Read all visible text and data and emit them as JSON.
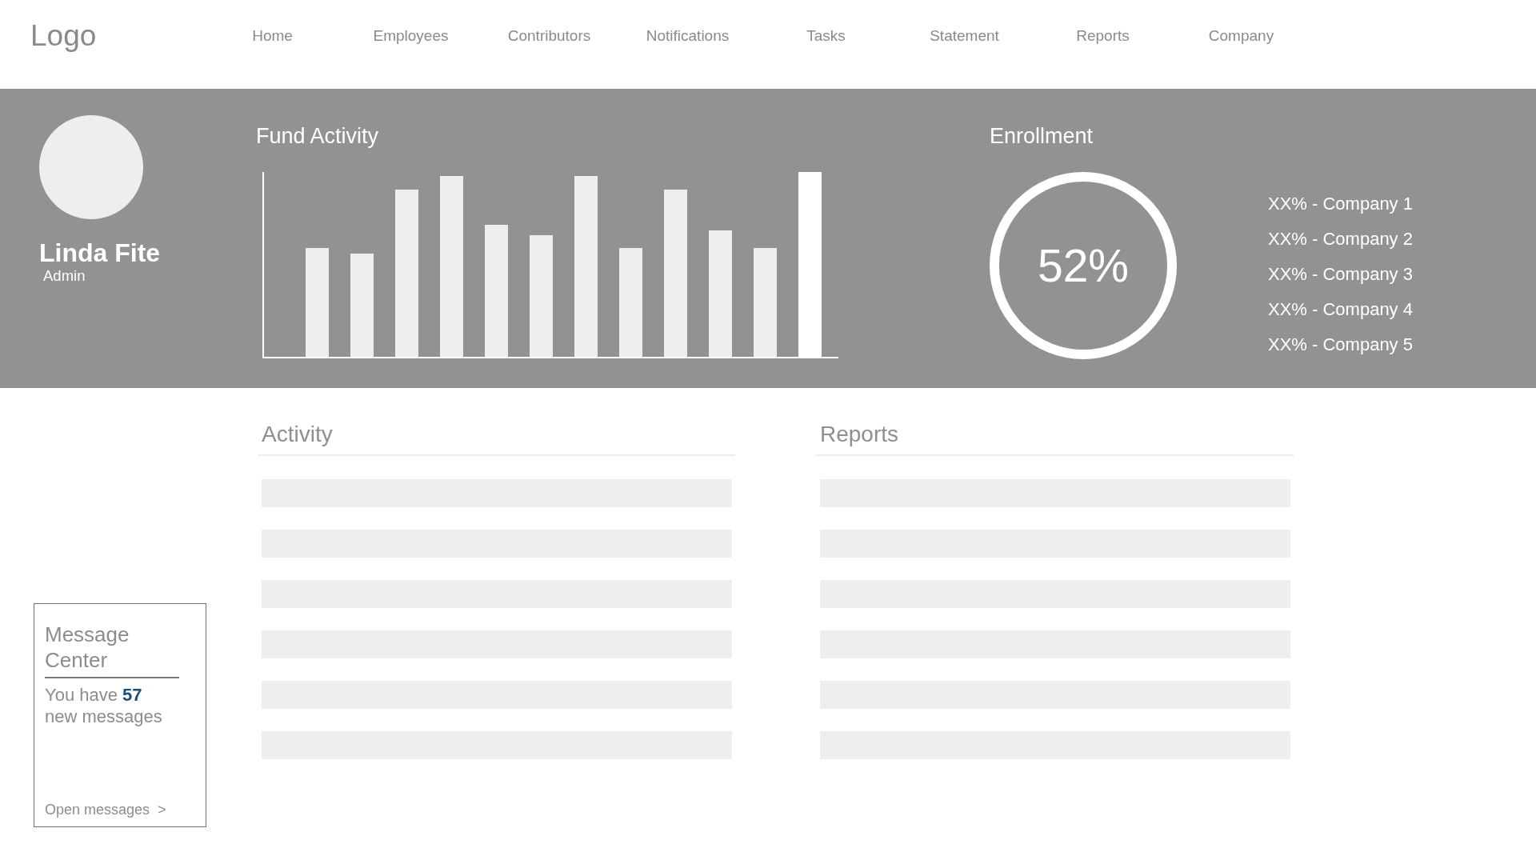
{
  "header": {
    "logo": "Logo",
    "nav": [
      "Home",
      "Employees",
      "Contributors",
      "Notifications",
      "Tasks",
      "Statement",
      "Reports",
      "Company"
    ]
  },
  "profile": {
    "name": "Linda Fite",
    "role": "Admin"
  },
  "fund_activity": {
    "title": "Fund Activity"
  },
  "enrollment": {
    "title": "Enrollment",
    "percent": "52%",
    "companies": [
      "XX% - Company 1",
      "XX% - Company 2",
      "XX% - Company 3",
      "XX% - Company 4",
      "XX% - Company 5"
    ]
  },
  "activity": {
    "title": "Activity",
    "rows": [
      {
        "kind": "placeholder"
      },
      {
        "kind": "placeholder"
      },
      {
        "kind": "placeholder"
      },
      {
        "kind": "placeholder"
      },
      {
        "kind": "placeholder"
      },
      {
        "kind": "placeholder"
      }
    ]
  },
  "reports": {
    "title": "Reports",
    "rows": [
      {
        "kind": "placeholder"
      },
      {
        "kind": "placeholder"
      },
      {
        "kind": "placeholder"
      },
      {
        "kind": "placeholder"
      },
      {
        "kind": "placeholder"
      },
      {
        "kind": "placeholder"
      }
    ]
  },
  "message_center": {
    "title": "Message Center",
    "text": "You have **57** new messages",
    "link": "Open messages",
    "link_arrow": ">"
  }
}
